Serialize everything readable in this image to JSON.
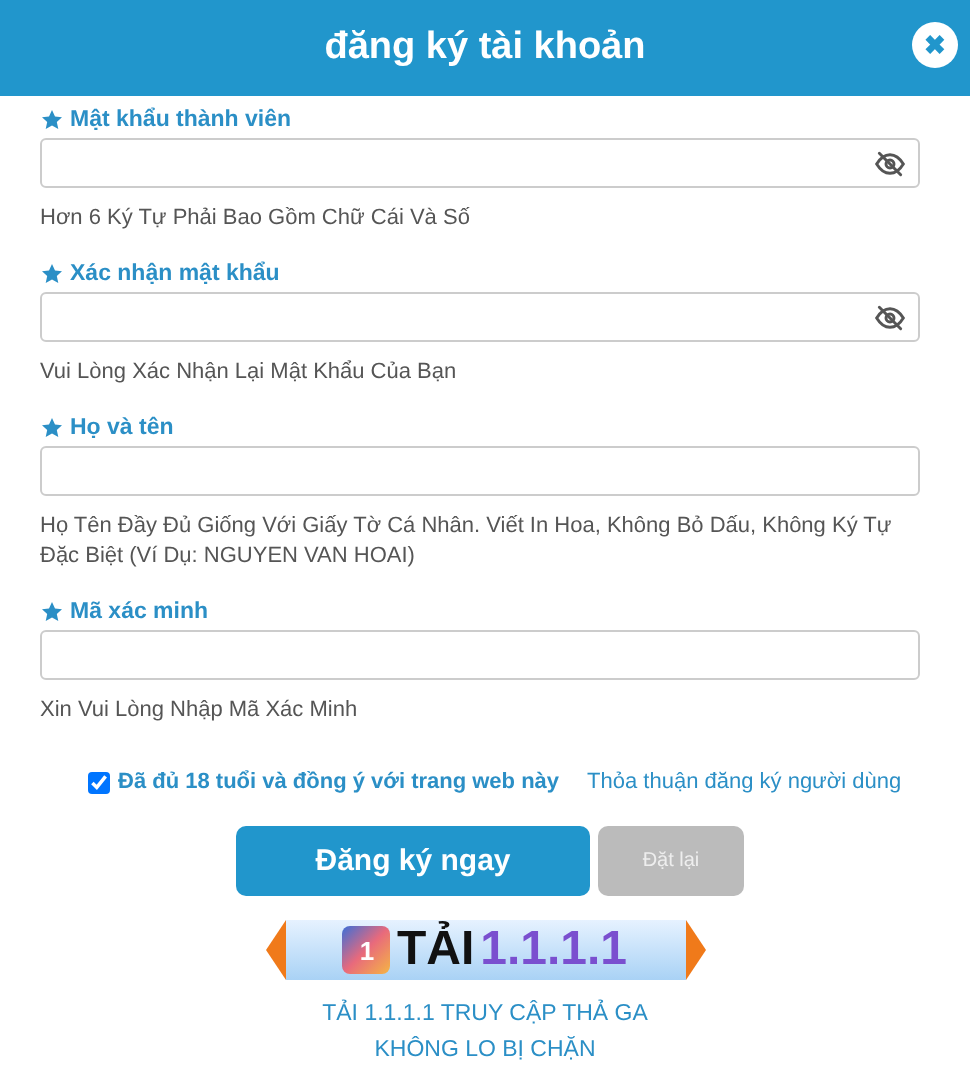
{
  "header": {
    "title": "đăng ký tài khoản",
    "close": "✖"
  },
  "fields": [
    {
      "label": "Mật khẩu thành viên",
      "kind": "password",
      "hint": "Hơn 6 Ký Tự Phải Bao Gồm Chữ Cái Và Số"
    },
    {
      "label": "Xác nhận mật khẩu",
      "kind": "password",
      "hint": "Vui Lòng Xác Nhận Lại Mật Khẩu Của Bạn"
    },
    {
      "label": "Họ và tên",
      "kind": "text",
      "hint": "Họ Tên Đầy Đủ Giống Với Giấy Tờ Cá Nhân. Viết In Hoa, Không Bỏ Dấu, Không Ký Tự Đặc Biệt (Ví Dụ: NGUYEN VAN HOAI)"
    },
    {
      "label": "Mã xác minh",
      "kind": "text",
      "hint": "Xin Vui Lòng Nhập Mã Xác Minh"
    }
  ],
  "agreement": {
    "checked": true,
    "label": "Đã đủ 18 tuổi và đồng ý với trang web này",
    "link": "Thỏa thuận đăng ký người dùng"
  },
  "buttons": {
    "submit": "Đăng ký ngay",
    "reset": "Đặt lại",
    "reset_disabled": true
  },
  "banner": {
    "badge": "1",
    "word": "TẢI",
    "number": "1.1.1.1"
  },
  "promo": [
    "TẢI 1.1.1.1 TRUY CẬP THẢ GA",
    "KHÔNG LO BỊ CHẶN"
  ]
}
